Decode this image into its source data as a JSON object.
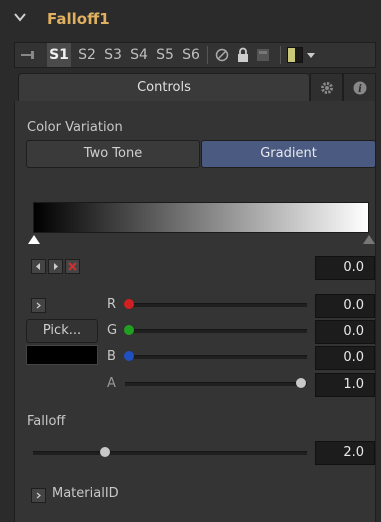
{
  "header": {
    "title": "Falloff1"
  },
  "toolbar": {
    "slots": [
      "S1",
      "S2",
      "S3",
      "S4",
      "S5",
      "S6"
    ]
  },
  "tabs": {
    "controls": "Controls"
  },
  "color_variation": {
    "label": "Color Variation",
    "options": [
      "Two Tone",
      "Gradient"
    ],
    "selected": "Gradient"
  },
  "gradient": {
    "from": "#000000",
    "to": "#ffffff",
    "value": "0.0"
  },
  "color": {
    "pick_label": "Pick...",
    "swatch": "#000000",
    "channels": [
      {
        "name": "R",
        "value": "0.0",
        "color": "#d02020",
        "level": 0.0
      },
      {
        "name": "G",
        "value": "0.0",
        "color": "#20a020",
        "level": 0.0
      },
      {
        "name": "B",
        "value": "0.0",
        "color": "#2050c0",
        "level": 0.0
      },
      {
        "name": "A",
        "value": "1.0",
        "color": "#c8c8c8",
        "level": 1.0
      }
    ]
  },
  "falloff": {
    "label": "Falloff",
    "value": "2.0",
    "level": 0.39
  },
  "material": {
    "label": "MaterialID"
  },
  "icons": {
    "header": "chevron-down-icon",
    "pin": "pin-icon",
    "disable": "disable-icon",
    "lock": "lock-icon",
    "cache": "cache-icon",
    "color": "color-swatch-icon",
    "settings": "gear-icon",
    "info": "info-icon"
  },
  "colors": {
    "title": "#e0b060",
    "accent_button": "#4a5a80"
  }
}
